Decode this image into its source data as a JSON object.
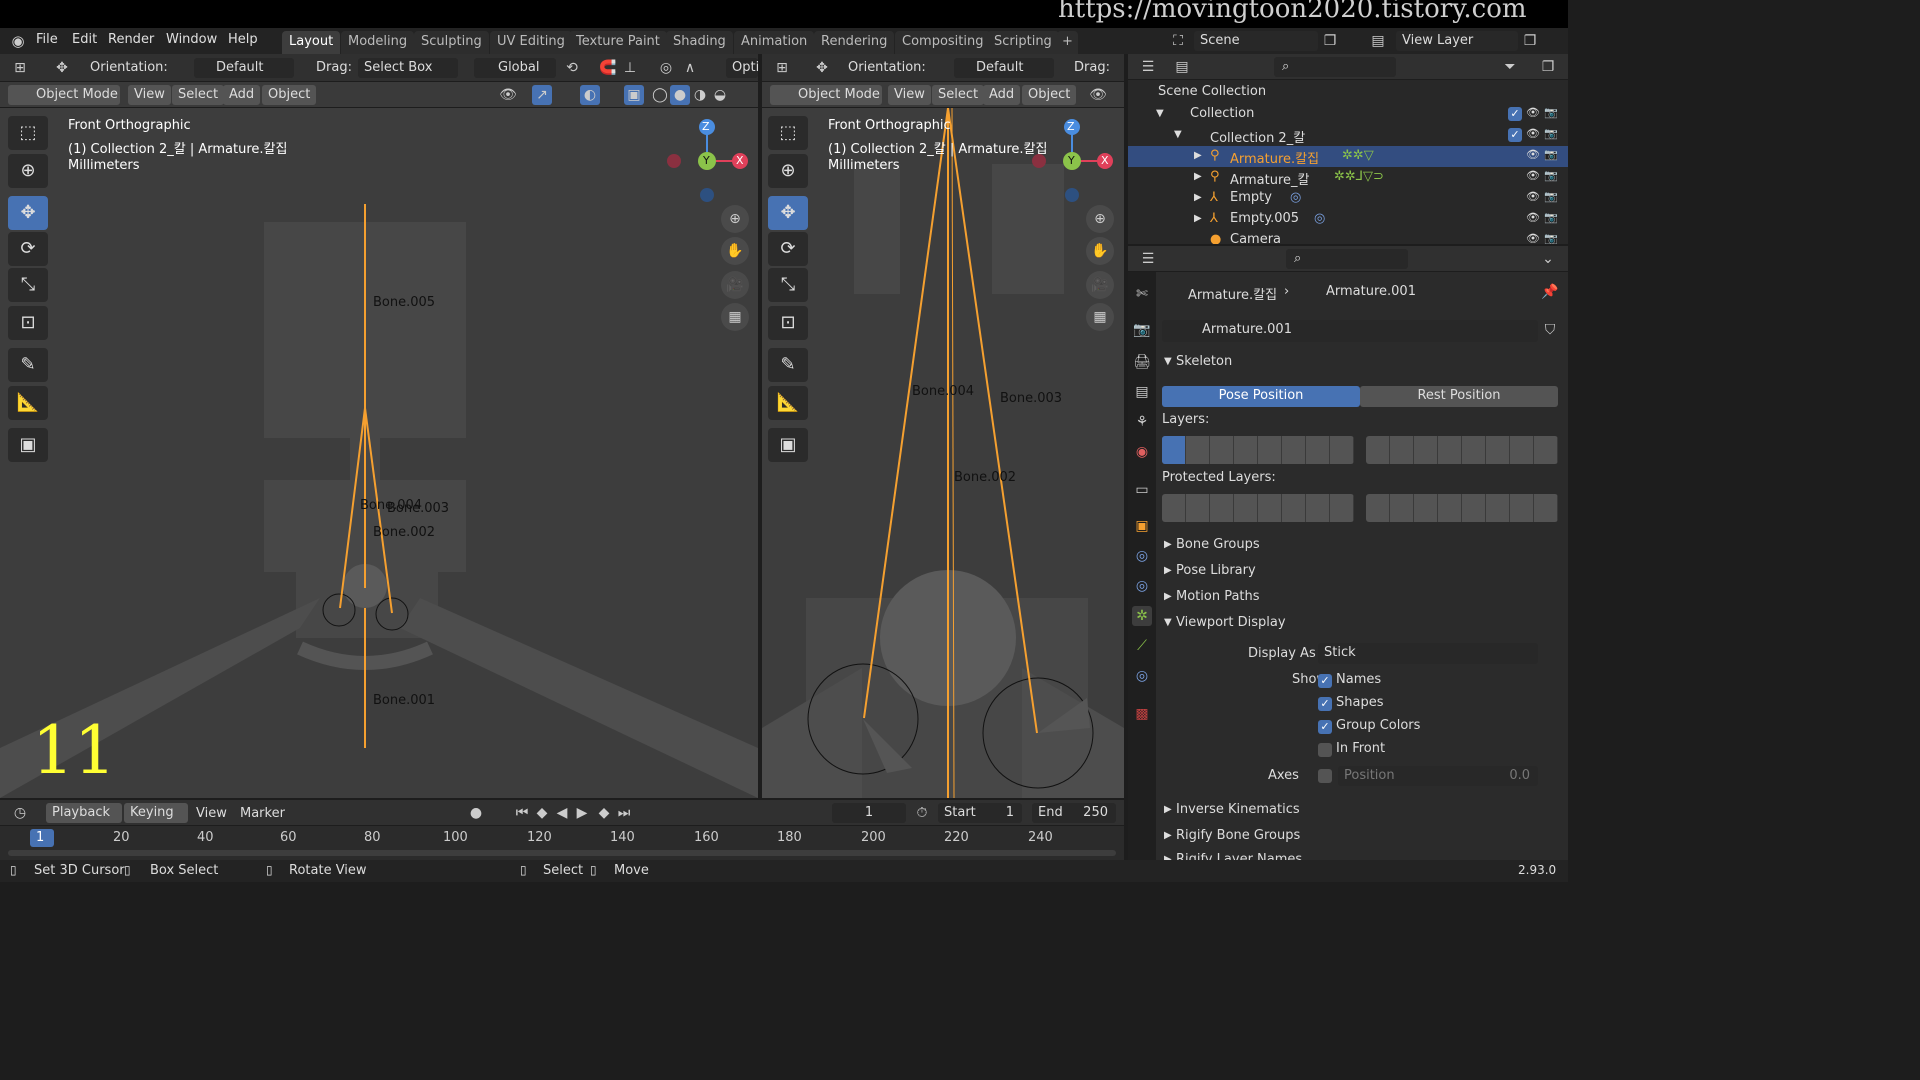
{
  "watermark": "https://movingtoon2020.tistory.com",
  "menu": [
    "File",
    "Edit",
    "Render",
    "Window",
    "Help"
  ],
  "workspaces": [
    "Layout",
    "Modeling",
    "Sculpting",
    "UV Editing",
    "Texture Paint",
    "Shading",
    "Animation",
    "Rendering",
    "Compositing",
    "Scripting"
  ],
  "scene": "Scene",
  "view_layer": "View Layer",
  "left_vp": {
    "orientation_label": "Orientation:",
    "orientation": "Default",
    "drag_label": "Drag:",
    "drag": "Select Box",
    "transform": "Global",
    "options": "Opti",
    "mode": "Object Mode",
    "view": "View",
    "select": "Select",
    "add": "Add",
    "object": "Object",
    "info1": "Front Orthographic",
    "info2": "(1) Collection 2_칼 | Armature.칼집",
    "info3": "Millimeters",
    "bones": [
      "Bone.005",
      "Bone.004",
      "Bone.003",
      "Bone.002",
      "Bone.001"
    ],
    "frame_overlay": "11"
  },
  "right_vp": {
    "orientation_label": "Orientation:",
    "orientation": "Default",
    "drag_label": "Drag:",
    "mode": "Object Mode",
    "view": "View",
    "select": "Select",
    "add": "Add",
    "object": "Object",
    "info1": "Front Orthographic",
    "info2": "(1) Collection 2_칼 | Armature.칼집",
    "info3": "Millimeters",
    "bones": [
      "Bone.004",
      "Bone.003",
      "Bone.002"
    ]
  },
  "gizmo": {
    "z": "Z",
    "y": "Y",
    "x": "X"
  },
  "outliner": {
    "root": "Scene Collection",
    "items": [
      "Collection",
      "Collection 2_칼",
      "Armature.칼집",
      "Armature_칼",
      "Empty",
      "Empty.005",
      "Camera"
    ]
  },
  "properties": {
    "breadcrumb_obj": "Armature.칼집",
    "breadcrumb_data": "Armature.001",
    "datablock": "Armature.001",
    "skeleton": "Skeleton",
    "pose_position": "Pose Position",
    "rest_position": "Rest Position",
    "layers": "Layers:",
    "protected_layers": "Protected Layers:",
    "bone_groups": "Bone Groups",
    "pose_library": "Pose Library",
    "motion_paths": "Motion Paths",
    "viewport_display": "Viewport Display",
    "display_as_label": "Display As",
    "display_as": "Stick",
    "show_label": "Show",
    "names": "Names",
    "shapes": "Shapes",
    "group_colors": "Group Colors",
    "in_front": "In Front",
    "axes_label": "Axes",
    "position_label": "Position",
    "position_value": "0.0",
    "inverse_kinematics": "Inverse Kinematics",
    "rigify_bone_groups": "Rigify Bone Groups",
    "rigify_layer_names": "Rigify Layer Names"
  },
  "timeline": {
    "playback": "Playback",
    "keying": "Keying",
    "view": "View",
    "marker": "Marker",
    "current": "1",
    "start_label": "Start",
    "start": "1",
    "end_label": "End",
    "end": "250",
    "ticks": [
      "1",
      "20",
      "40",
      "60",
      "80",
      "100",
      "120",
      "140",
      "160",
      "180",
      "200",
      "220",
      "240"
    ]
  },
  "statusbar": {
    "set_cursor": "Set 3D Cursor",
    "box_select": "Box Select",
    "rotate_view": "Rotate View",
    "select": "Select",
    "move": "Move",
    "version": "2.93.0"
  },
  "colors": {
    "accent": "#4772b3",
    "bone": "#f5a030",
    "x": "#e0405a",
    "y": "#8bc34a",
    "z": "#4a8de0"
  }
}
